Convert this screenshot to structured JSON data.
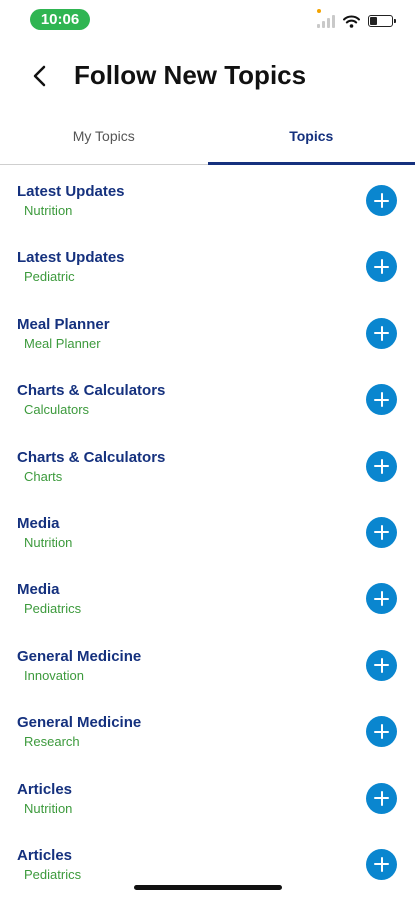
{
  "status_bar": {
    "time": "10:06"
  },
  "header": {
    "title": "Follow New Topics"
  },
  "tabs": [
    {
      "label": "My Topics",
      "active": false
    },
    {
      "label": "Topics",
      "active": true
    }
  ],
  "topics": [
    {
      "title": "Latest Updates",
      "subtitle": "Nutrition"
    },
    {
      "title": "Latest Updates",
      "subtitle": "Pediatric"
    },
    {
      "title": "Meal Planner",
      "subtitle": "Meal Planner"
    },
    {
      "title": "Charts & Calculators",
      "subtitle": "Calculators"
    },
    {
      "title": "Charts & Calculators",
      "subtitle": "Charts"
    },
    {
      "title": "Media",
      "subtitle": "Nutrition"
    },
    {
      "title": "Media",
      "subtitle": "Pediatrics"
    },
    {
      "title": "General Medicine",
      "subtitle": "Innovation"
    },
    {
      "title": "General Medicine",
      "subtitle": "Research"
    },
    {
      "title": "Articles",
      "subtitle": "Nutrition"
    },
    {
      "title": "Articles",
      "subtitle": "Pediatrics"
    }
  ],
  "colors": {
    "accent": "#15317e",
    "subtitle": "#3c9a3c",
    "add_button": "#0a86cf",
    "time_pill": "#2fb552"
  }
}
